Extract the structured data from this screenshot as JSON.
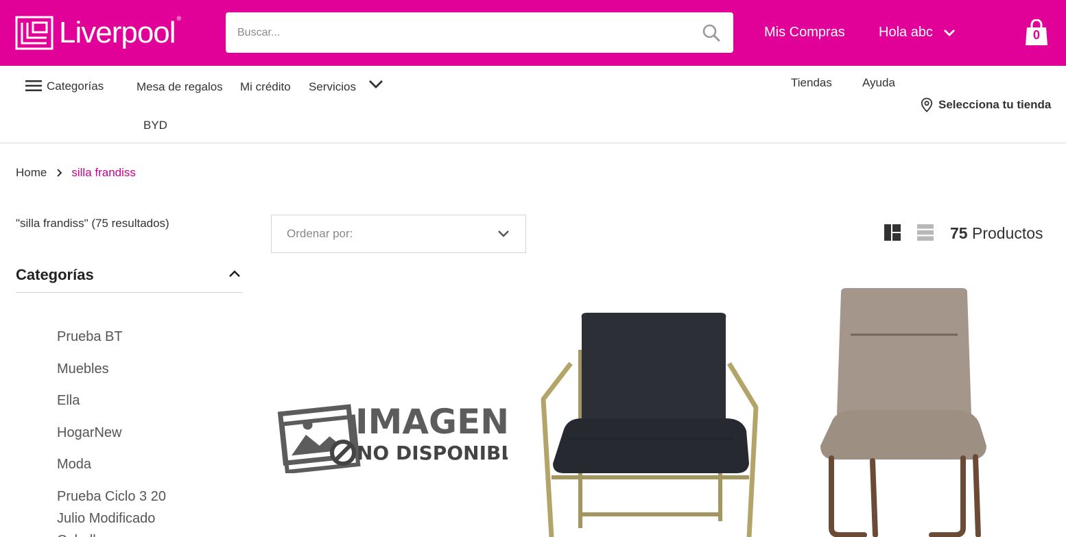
{
  "header": {
    "logo_text": "Liverpool",
    "logo_reg": "®",
    "search_placeholder": "Buscar...",
    "mis_compras": "Mis Compras",
    "greeting": "Hola abc",
    "cart_count": "0",
    "brand_color": "#e10098"
  },
  "nav": {
    "categories": "Categorías",
    "mesa": "Mesa de regalos",
    "credito": "Mi crédito",
    "servicios": "Servicios",
    "byd": "BYD",
    "tiendas": "Tiendas",
    "ayuda": "Ayuda",
    "store": "Selecciona tu tienda"
  },
  "breadcrumb": {
    "home": "Home",
    "current": "silla frandiss"
  },
  "sidebar": {
    "results": "\"silla frandiss\" (75 resultados)",
    "categories_title": "Categorías",
    "items": [
      "Prueba BT",
      "Muebles",
      "Ella",
      "HogarNew",
      "Moda",
      "Prueba Ciclo 3 20 Julio Modificado",
      "Caballeros"
    ]
  },
  "toolbar": {
    "sort_label": "Ordenar por:",
    "count_number": "75",
    "count_label": "Productos"
  },
  "products": [
    {
      "image": "imagen-no-disponible",
      "placeholder_line1": "IMAGEN",
      "placeholder_line2": "NO DISPONIBLE"
    },
    {
      "image": "black-armchair-gold-frame"
    },
    {
      "image": "beige-chair-wood-legs"
    }
  ]
}
